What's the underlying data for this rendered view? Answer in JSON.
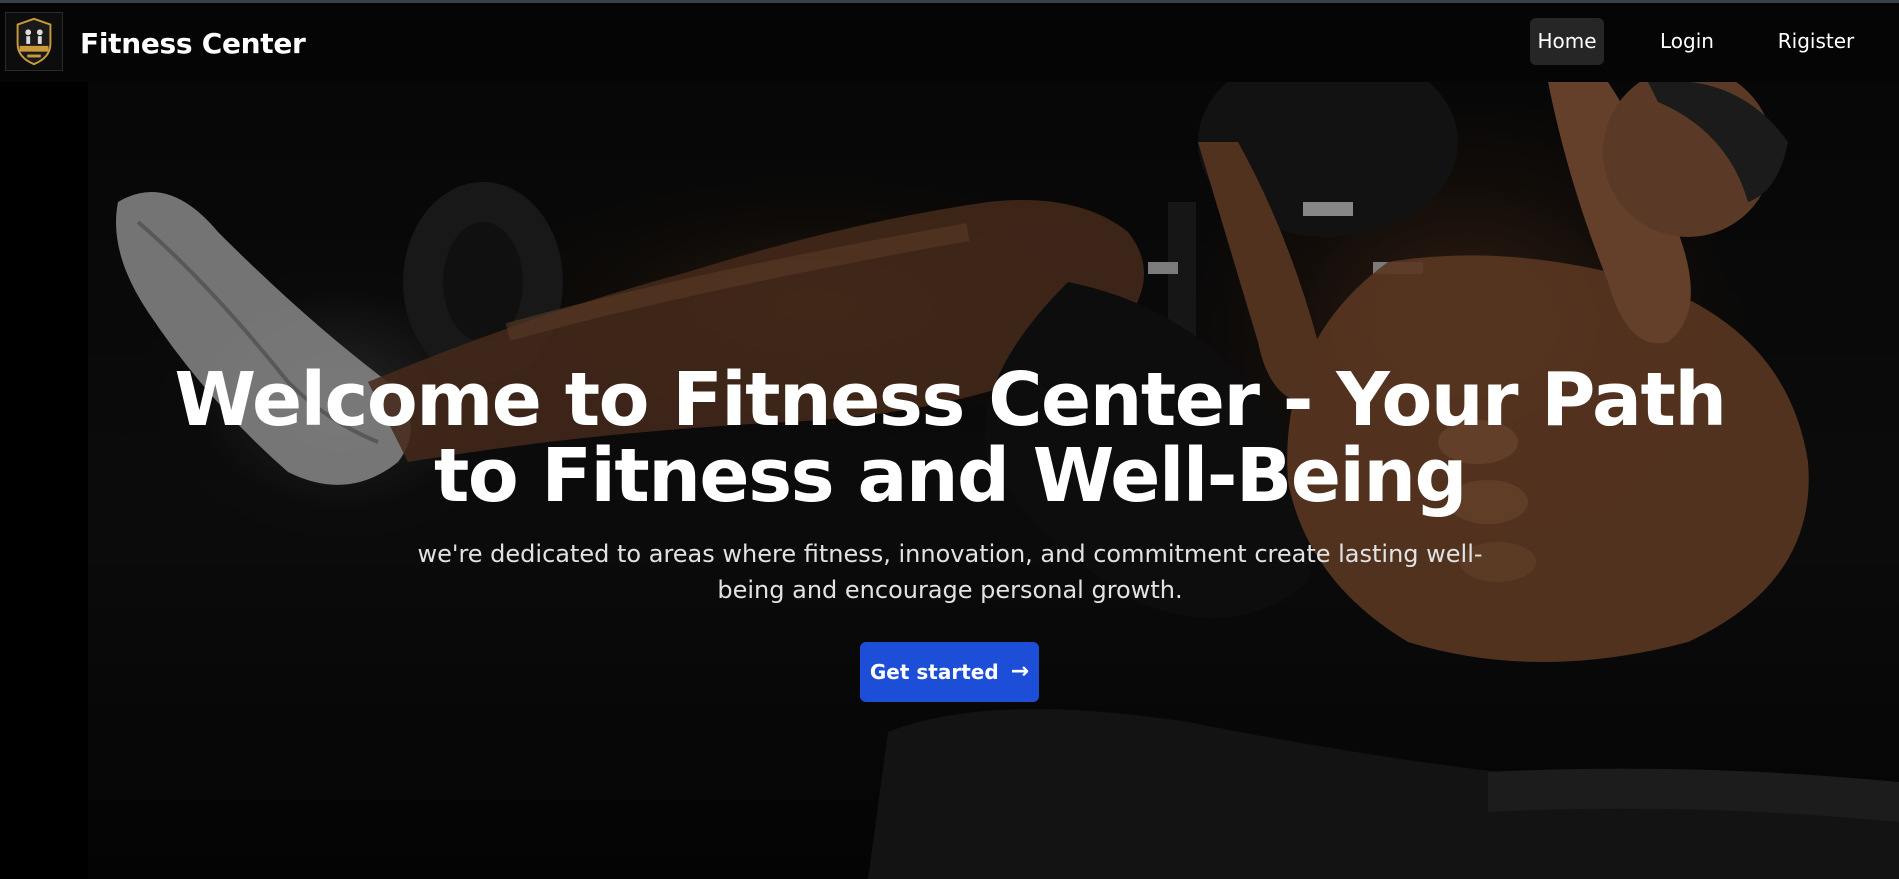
{
  "header": {
    "brand": "Fitness Center",
    "logo_icon": "fitness-badge-logo",
    "nav": [
      {
        "label": "Home",
        "active": true
      },
      {
        "label": "Login",
        "active": false
      },
      {
        "label": "Rigister",
        "active": false
      }
    ]
  },
  "hero": {
    "title": "Welcome to Fitness Center - Your Path to Fitness and Well-Being",
    "subtitle": "we're dedicated to areas where fitness, innovation, and commitment create lasting well-being and encourage personal growth.",
    "cta_label": "Get started",
    "cta_icon": "arrow-right-icon",
    "background": "dark gym photo of athlete doing ab exercise"
  },
  "colors": {
    "navbar_bg": "#050505",
    "active_nav_bg": "#262626",
    "cta_bg": "#1d4ed8",
    "text": "#ffffff"
  }
}
